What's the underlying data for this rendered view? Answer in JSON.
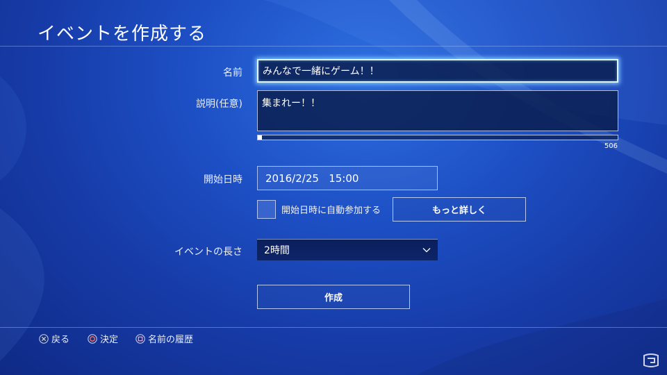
{
  "screen": {
    "title": "イベントを作成する"
  },
  "form": {
    "name": {
      "label": "名前",
      "value": "みんなで一緒にゲーム！！"
    },
    "description": {
      "label": "説明(任意)",
      "value": "集まれー！！",
      "remaining_chars": "506",
      "usage_fraction": 0.012
    },
    "start": {
      "label": "開始日時",
      "value": "2016/2/25   15:00"
    },
    "auto_join": {
      "label": "開始日時に自動参加する",
      "checked": false
    },
    "more_button": "もっと詳しく",
    "duration": {
      "label": "イベントの長さ",
      "value": "2時間"
    },
    "create_button": "作成"
  },
  "footer": {
    "hints": [
      {
        "icon": "cross-button-icon",
        "label": "戻る"
      },
      {
        "icon": "circle-button-icon",
        "label": "決定"
      },
      {
        "icon": "square-button-icon",
        "label": "名前の履歴"
      }
    ]
  },
  "colors": {
    "accent_glow": "#8cd2ff",
    "background": "#1d4fc4",
    "field_bg": "#0a1e50"
  }
}
